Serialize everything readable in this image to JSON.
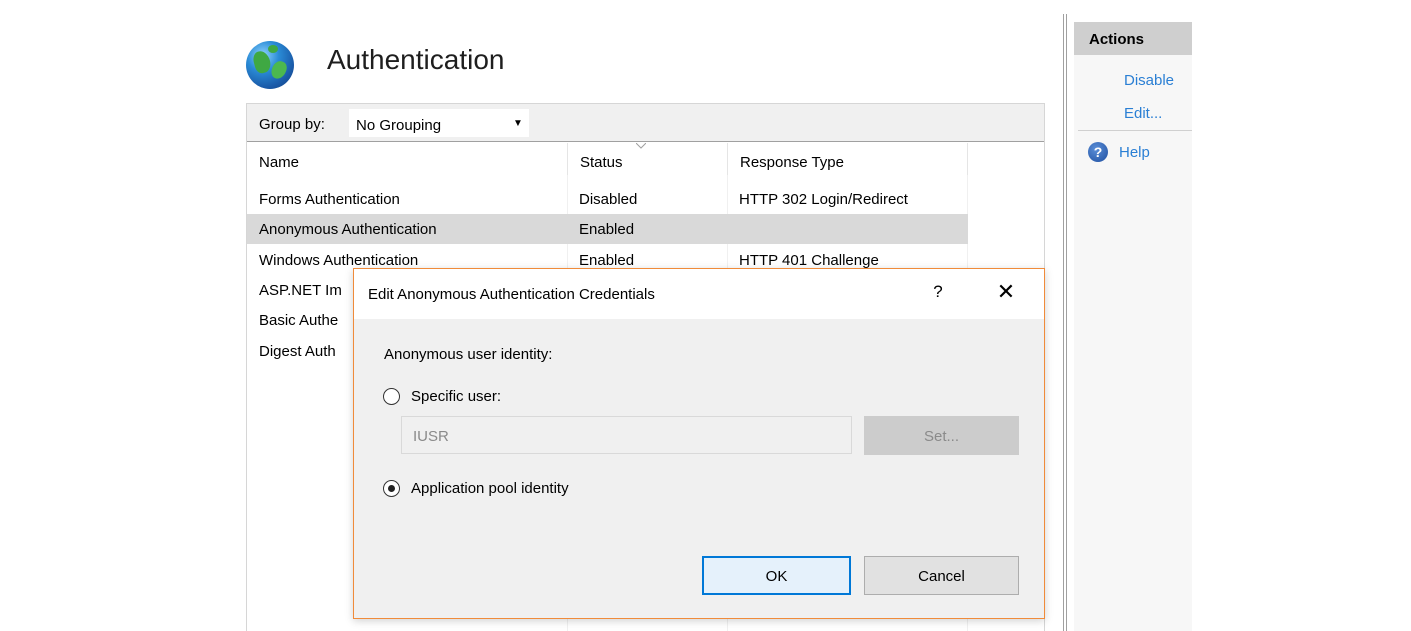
{
  "header": {
    "title": "Authentication",
    "icon": "globe-icon"
  },
  "group_by": {
    "label": "Group by:",
    "value": "No Grouping"
  },
  "columns": [
    "Name",
    "Status",
    "Response Type"
  ],
  "rows": [
    {
      "name": "Forms Authentication",
      "status": "Disabled",
      "response": "HTTP 302 Login/Redirect"
    },
    {
      "name": "Anonymous Authentication",
      "status": "Enabled",
      "response": ""
    },
    {
      "name": "Windows Authentication",
      "status": "Enabled",
      "response": "HTTP 401 Challenge"
    },
    {
      "name": "ASP.NET Im",
      "status": "",
      "response": ""
    },
    {
      "name": "Basic Authe",
      "status": "",
      "response": ""
    },
    {
      "name": "Digest Auth",
      "status": "",
      "response": ""
    }
  ],
  "actions": {
    "title": "Actions",
    "disable": "Disable",
    "edit": "Edit...",
    "help": "Help"
  },
  "dialog": {
    "title": "Edit Anonymous Authentication Credentials",
    "help_glyph": "?",
    "close_glyph": "✕",
    "identity_label": "Anonymous user identity:",
    "specific_user_label": "Specific user:",
    "specific_user_value": "IUSR",
    "set_button": "Set...",
    "app_pool_label": "Application pool identity",
    "selected_option": "Application pool identity",
    "ok": "OK",
    "cancel": "Cancel"
  },
  "colors": {
    "accent": "#0078d7",
    "dialog_border": "#f08b3a",
    "link": "#2a7fd4",
    "selection": "#d9d9d9"
  }
}
